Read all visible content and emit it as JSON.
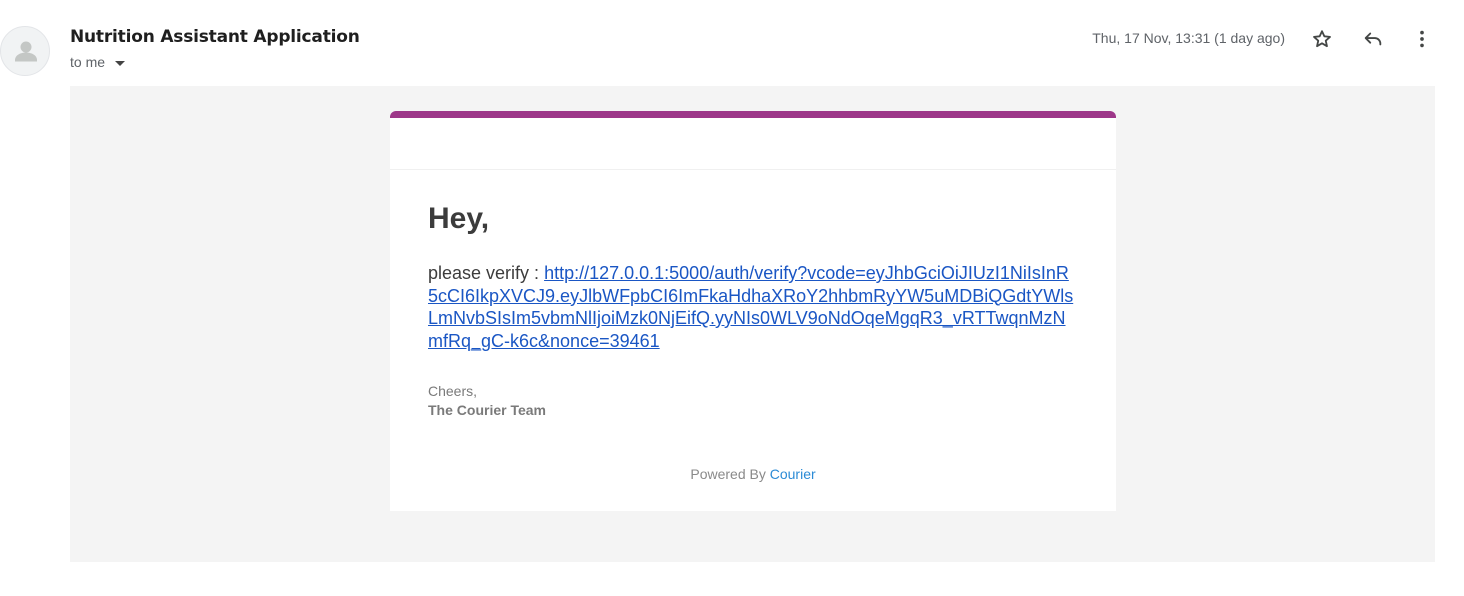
{
  "header": {
    "sender": "Nutrition Assistant Application",
    "recipient": "to me",
    "date": "Thu, 17 Nov, 13:31 (1 day ago)",
    "icons": [
      "star-icon",
      "reply-icon",
      "more-vert-icon"
    ]
  },
  "email": {
    "accent_color": "#9d3789",
    "greeting": "Hey,",
    "verify_prefix": "please verify : ",
    "verify_link": "http://127.0.0.1:5000/auth/verify?vcode=eyJhbGciOiJIUzI1NiIsInR5cCI6IkpXVCJ9.eyJlbWFpbCI6ImFkaHdhaXRoY2hhbmRyYW5uMDBiQGdtYWlsLmNvbSIsIm5vbmNlIjoiMzk0NjEifQ.yyNIs0WLV9oNdOqeMgqR3_vRTTwqnMzNmfRq_gC-k6c&nonce=39461",
    "signoff": "Cheers,",
    "team": "The Courier Team",
    "powered_by": "Powered By",
    "powered_by_link": "Courier"
  }
}
